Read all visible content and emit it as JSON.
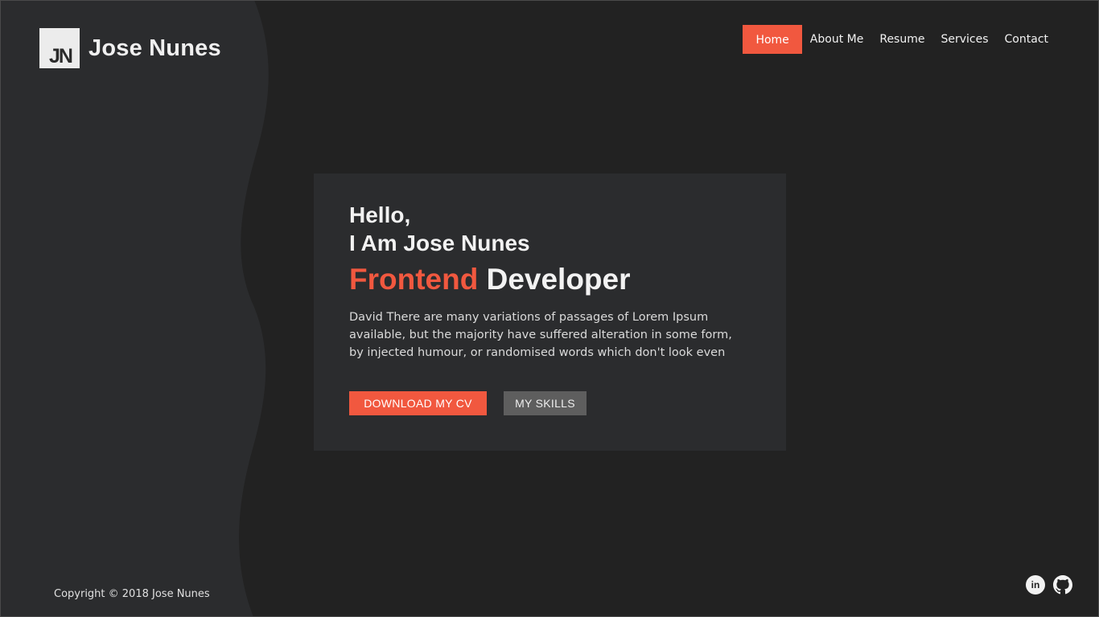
{
  "brand": {
    "logo_text": "JN",
    "name": "Jose Nunes"
  },
  "nav": {
    "items": [
      {
        "label": "Home",
        "active": true
      },
      {
        "label": "About Me"
      },
      {
        "label": "Resume"
      },
      {
        "label": "Services"
      },
      {
        "label": "Contact"
      }
    ]
  },
  "hero": {
    "greeting_line1": "Hello,",
    "greeting_line2": "I Am Jose Nunes",
    "role_accent": "Frontend",
    "role_rest": "Developer",
    "description_lines": [
      "David There are many variations of passages of Lorem Ipsum",
      "available, but the majority have suffered alteration in some form,",
      "by injected humour, or randomised words which don't look even"
    ],
    "primary_button": "DOWNLOAD MY CV",
    "secondary_button": "MY SKILLS"
  },
  "footer": {
    "copyright": "Copyright © 2018 Jose Nunes"
  },
  "social": {
    "linkedin_icon": "linkedin-icon",
    "linkedin_glyph": "in",
    "github_icon": "github-icon"
  },
  "colors": {
    "accent": "#f1583f",
    "background": "#222222",
    "panel": "#2b2c2e",
    "secondary_button": "#5e5e5e"
  }
}
